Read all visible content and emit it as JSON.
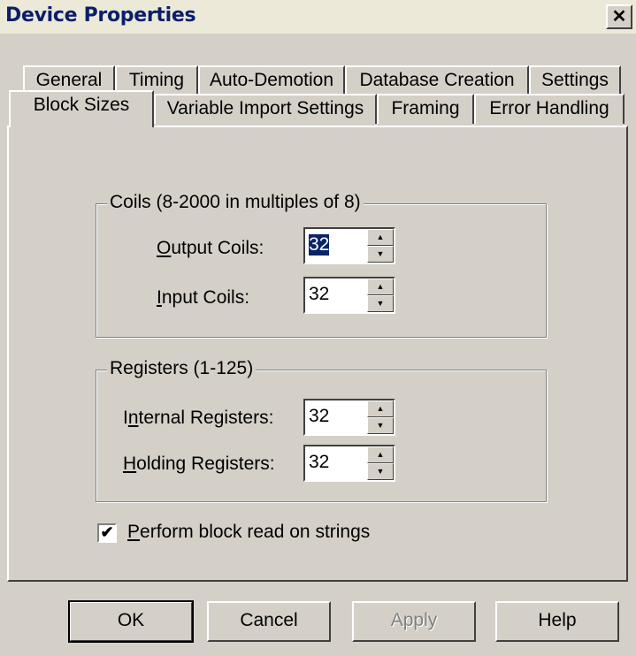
{
  "window": {
    "title": "Device Properties",
    "close_glyph": "✕"
  },
  "tabs_row1": [
    "General",
    "Timing",
    "Auto-Demotion",
    "Database Creation",
    "Settings"
  ],
  "tabs_row2": [
    "Block Sizes",
    "Variable Import Settings",
    "Framing",
    "Error Handling"
  ],
  "active_tab": "Block Sizes",
  "coils": {
    "legend": "Coils (8-2000 in multiples of 8)",
    "output_label_key": "O",
    "output_label_rest": "utput Coils:",
    "output_value": "32",
    "input_label_key": "I",
    "input_label_rest": "nput Coils:",
    "input_value": "32"
  },
  "registers": {
    "legend": "Registers (1-125)",
    "internal_label_pre": "I",
    "internal_label_key": "n",
    "internal_label_rest": "ternal Registers:",
    "internal_value": "32",
    "holding_label_key": "H",
    "holding_label_rest": "olding Registers:",
    "holding_value": "32"
  },
  "block_read": {
    "checked": true,
    "label_key": "P",
    "label_rest": "erform block read on strings"
  },
  "buttons": {
    "ok": "OK",
    "cancel": "Cancel",
    "apply": "Apply",
    "help": "Help"
  },
  "icons": {
    "spin_up": "up-arrow-icon",
    "spin_down": "down-arrow-icon",
    "check": "checkmark-icon"
  }
}
